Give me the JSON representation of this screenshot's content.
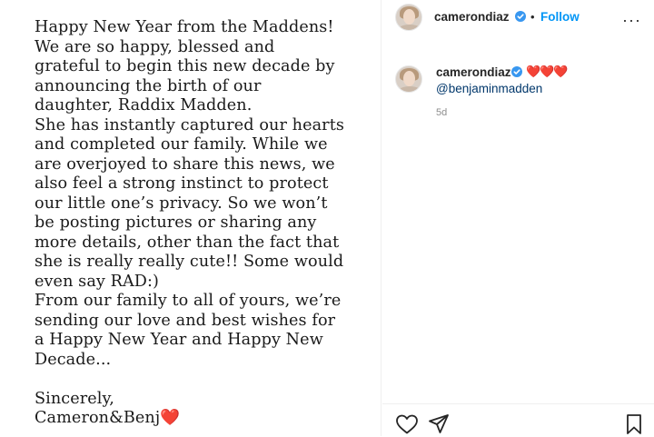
{
  "post": {
    "letter_lines": [
      "Happy New Year from the Maddens!",
      "We are so happy, blessed and",
      "grateful to begin this new decade by",
      "announcing the birth of our",
      "daughter, Raddix Madden.",
      "She has instantly captured our hearts",
      "and completed our family. While we",
      "are overjoyed to share this news, we",
      "also feel a strong instinct to protect",
      "our little one’s privacy. So we won’t",
      "be posting pictures or sharing any",
      "more details, other than the fact that",
      "she is really really cute!! Some would",
      "even say RAD:)",
      "From our family to all of yours, we’re",
      "sending our love and best wishes for",
      "a Happy New Year and Happy New",
      "Decade..."
    ],
    "closing": "Sincerely,",
    "signature": "Cameron&Benj",
    "signature_heart": "❤️"
  },
  "header": {
    "username": "camerondiaz",
    "separator": "•",
    "follow_label": "Follow",
    "more_label": "···"
  },
  "caption": {
    "username": "camerondiaz",
    "hearts": "❤️❤️❤️",
    "mention": "@benjaminmadden",
    "time": "5d"
  },
  "colors": {
    "verified": "#3897f0",
    "follow": "#0095f6",
    "heart": "#e0245e"
  },
  "icons": {
    "like": "heart-outline-icon",
    "share": "paper-plane-icon",
    "save": "bookmark-icon",
    "more": "ellipsis-icon",
    "verified": "verified-badge-icon"
  }
}
